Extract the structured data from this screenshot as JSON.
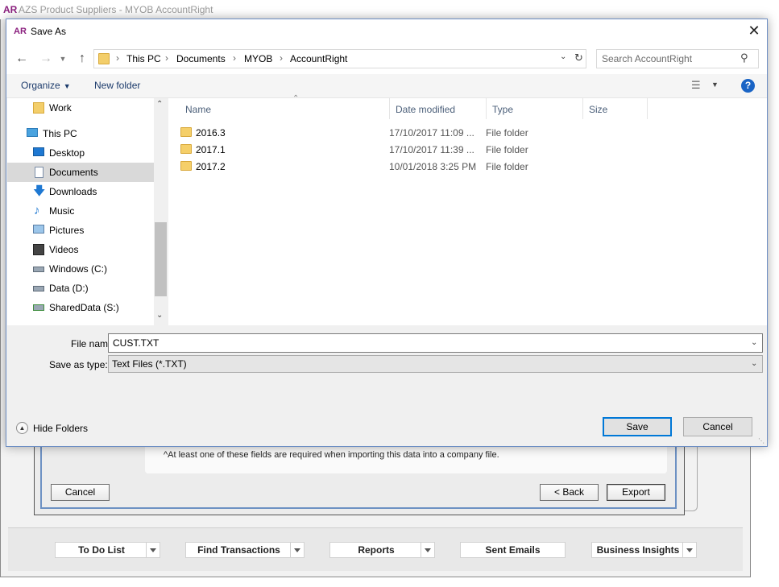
{
  "background": {
    "app_logo": "AR",
    "window_title": "AZS Product Suppliers - MYOB AccountRight",
    "note": "^At least one of these fields are required when importing this data into a company file.",
    "cancel_label": "Cancel",
    "back_label": "< Back",
    "export_label": "Export",
    "bottom_nav": [
      {
        "label": "To Do List"
      },
      {
        "label": "Find Transactions"
      },
      {
        "label": "Reports"
      },
      {
        "label": "Sent Emails"
      },
      {
        "label": "Business Insights"
      }
    ]
  },
  "dialog": {
    "logo": "AR",
    "title": "Save As",
    "close_glyph": "✕",
    "breadcrumbs": [
      "This PC",
      "Documents",
      "MYOB",
      "AccountRight"
    ],
    "search_placeholder": "Search AccountRight",
    "toolbar": {
      "organize_label": "Organize",
      "new_folder_label": "New folder",
      "help_glyph": "?"
    },
    "nav_items": [
      {
        "label": "Work",
        "icon": "work-folder-icon"
      },
      {
        "label": "This PC",
        "icon": "computer-icon"
      },
      {
        "label": "Desktop",
        "icon": "desktop-icon"
      },
      {
        "label": "Documents",
        "icon": "documents-icon"
      },
      {
        "label": "Downloads",
        "icon": "downloads-icon"
      },
      {
        "label": "Music",
        "icon": "music-icon"
      },
      {
        "label": "Pictures",
        "icon": "pictures-icon"
      },
      {
        "label": "Videos",
        "icon": "videos-icon"
      },
      {
        "label": "Windows (C:)",
        "icon": "drive-c-icon"
      },
      {
        "label": "Data (D:)",
        "icon": "drive-d-icon"
      },
      {
        "label": "SharedData (S:)",
        "icon": "network-drive-icon"
      }
    ],
    "columns": [
      "Name",
      "Date modified",
      "Type",
      "Size"
    ],
    "files": [
      {
        "name": "2016.3",
        "date": "17/10/2017 11:09 ...",
        "type": "File folder"
      },
      {
        "name": "2017.1",
        "date": "17/10/2017 11:39 ...",
        "type": "File folder"
      },
      {
        "name": "2017.2",
        "date": "10/01/2018 3:25 PM",
        "type": "File folder"
      }
    ],
    "file_name_label": "File name:",
    "file_name_value": "CUST.TXT",
    "save_type_label": "Save as type:",
    "save_type_value": "Text Files (*.TXT)",
    "hide_folders_label": "Hide Folders",
    "save_label": "Save",
    "cancel_label": "Cancel"
  }
}
